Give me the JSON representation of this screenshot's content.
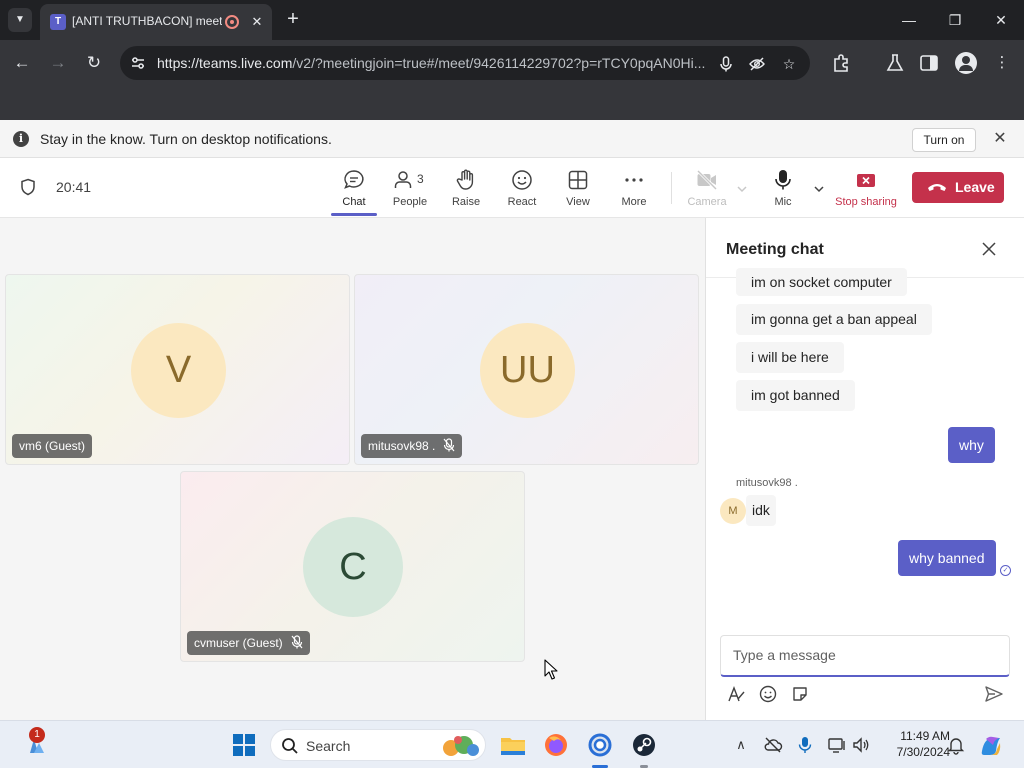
{
  "browser": {
    "tab_title": "[ANTI TRUTHBACON] meeting",
    "url_domain": "https://teams.live.com",
    "url_path": "/v2/?meetingjoin=true#/meet/9426114229702?p=rTCY0pqAN0Hi..."
  },
  "notification": {
    "message": "Stay in the know. Turn on desktop notifications.",
    "turn_on_label": "Turn on"
  },
  "meeting": {
    "timer": "20:41",
    "controls": {
      "chat": "Chat",
      "people": "People",
      "people_count": "3",
      "raise": "Raise",
      "react": "React",
      "view": "View",
      "more": "More",
      "camera": "Camera",
      "mic": "Mic",
      "stop_sharing": "Stop sharing",
      "leave": "Leave"
    }
  },
  "participants": [
    {
      "initials": "V",
      "name": "vm6 (Guest)",
      "muted": false,
      "color": "#fbe8c0",
      "text_color": "#8a6a2b"
    },
    {
      "initials": "UU",
      "name": "mitusovk98 .",
      "muted": true,
      "color": "#fbe8c0",
      "text_color": "#8a6a2b"
    },
    {
      "initials": "C",
      "name": "cvmuser (Guest)",
      "muted": true,
      "color": "#d6e8dc",
      "text_color": "#2b4a35"
    }
  ],
  "chat": {
    "title": "Meeting chat",
    "messages_in": [
      "im on socket computer",
      "im gonna get a ban appeal",
      "i will be here",
      "im got banned"
    ],
    "messages_out": [
      "why",
      "why banned"
    ],
    "reply_sender": "mitusovk98 .",
    "reply_sender_initial": "M",
    "reply_text": "idk",
    "compose_placeholder": "Type a message"
  },
  "taskbar": {
    "search_label": "Search",
    "notification_badge": "1",
    "time": "11:49 AM",
    "date": "7/30/2024"
  },
  "colors": {
    "teams_purple": "#5b5fc7",
    "leave_red": "#c4314b"
  }
}
